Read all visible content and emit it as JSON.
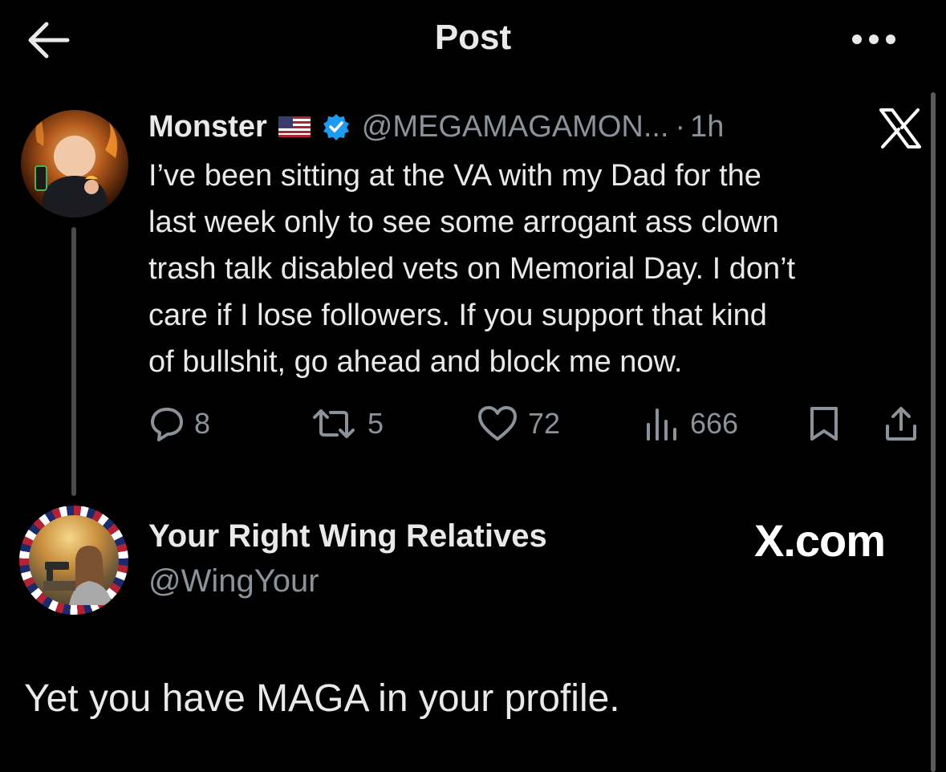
{
  "header": {
    "title": "Post",
    "back_icon": "arrow-left-icon",
    "more_icon": "more-horizontal-icon"
  },
  "post": {
    "author_name": "Monster",
    "flag": "🇺🇸",
    "verified": true,
    "handle": "@MEGAMAGAMON...",
    "separator": "·",
    "time": "1h",
    "text_lines": [
      "I’ve been sitting at the VA with my Dad for the",
      "last week only to see some arrogant ass clown",
      "trash talk disabled vets on Memorial Day. I don’t",
      "care if I lose followers. If you support that kind",
      "of bullshit, go ahead and block me now."
    ],
    "stats": {
      "replies": "8",
      "reposts": "5",
      "likes": "72",
      "views": "666"
    }
  },
  "quote_card": {
    "author_name": "Your Right Wing Relatives",
    "handle": "@WingYour",
    "brand": "X.com",
    "text": "Yet you have MAGA in your profile."
  },
  "colors": {
    "background": "#000000",
    "text": "#e7e9ea",
    "muted": "#8b9299",
    "verified_blue": "#1d9bf0"
  }
}
